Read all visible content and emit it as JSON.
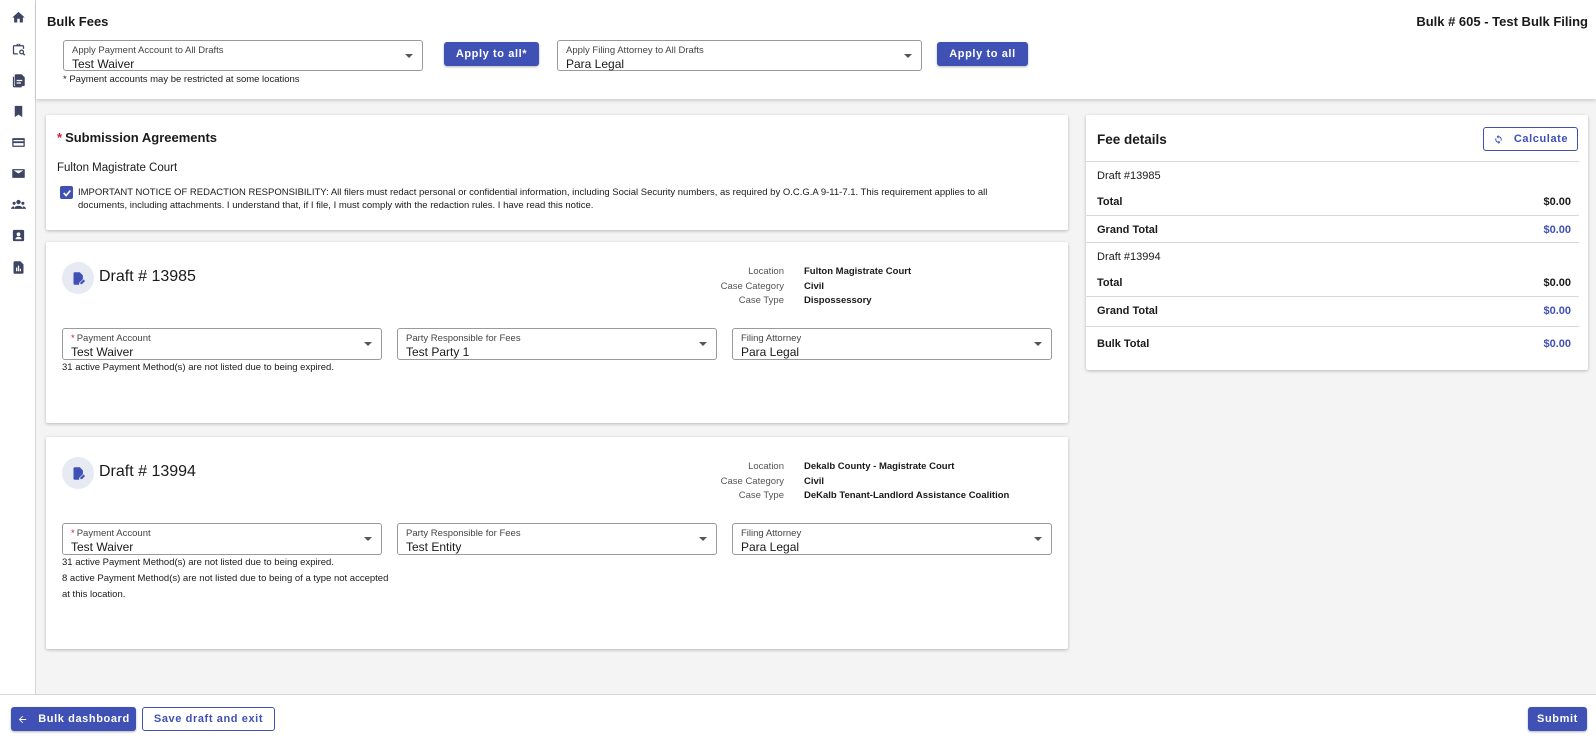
{
  "header": {
    "title": "Bulk Fees",
    "bulk_title": "Bulk # 605 - Test Bulk Filing",
    "payment_account_select": {
      "label": "Apply Payment Account to All Drafts",
      "value": "Test Waiver"
    },
    "apply_payment_label": "Apply to all*",
    "filing_attorney_select": {
      "label": "Apply Filing Attorney to All Drafts",
      "value": "Para Legal"
    },
    "apply_attorney_label": "Apply to all",
    "note": "* Payment accounts may be restricted at some locations"
  },
  "sidebar": {
    "items": [
      "home-icon",
      "briefcase-search-icon",
      "documents-icon",
      "bookmark-icon",
      "payment-card-icon",
      "mail-icon",
      "people-icon",
      "contact-card-icon",
      "report-icon"
    ]
  },
  "agreements": {
    "required_mark": "*",
    "title": "Submission Agreements",
    "court": "Fulton Magistrate Court",
    "checked": true,
    "text": "IMPORTANT NOTICE OF REDACTION RESPONSIBILITY: All filers must redact personal or confidential information, including Social Security numbers, as required by O.C.G.A 9-11-7.1. This requirement applies to all documents, including attachments. I understand that, if I file, I must comply with the redaction rules. I have read this notice."
  },
  "drafts": [
    {
      "title": "Draft # 13985",
      "location_label": "Location",
      "location": "Fulton Magistrate Court",
      "category_label": "Case Category",
      "category": "Civil",
      "type_label": "Case Type",
      "type": "Dispossessory",
      "payment_account": {
        "required": "*",
        "label": "Payment Account",
        "value": "Test Waiver"
      },
      "party": {
        "label": "Party Responsible for Fees",
        "value": "Test Party 1"
      },
      "attorney": {
        "label": "Filing Attorney",
        "value": "Para Legal"
      },
      "messages": [
        "31 active Payment Method(s) are not listed due to being expired."
      ]
    },
    {
      "title": "Draft # 13994",
      "location_label": "Location",
      "location": "Dekalb County - Magistrate Court",
      "category_label": "Case Category",
      "category": "Civil",
      "type_label": "Case Type",
      "type": "DeKalb Tenant-Landlord Assistance Coalition",
      "payment_account": {
        "required": "*",
        "label": "Payment Account",
        "value": "Test Waiver"
      },
      "party": {
        "label": "Party Responsible for Fees",
        "value": "Test Entity"
      },
      "attorney": {
        "label": "Filing Attorney",
        "value": "Para Legal"
      },
      "messages": [
        "31 active Payment Method(s) are not listed due to being expired.",
        "8 active Payment Method(s) are not listed due to being of a type not accepted",
        "at this location."
      ]
    }
  ],
  "fees": {
    "title": "Fee details",
    "calculate_label": "Calculate",
    "drafts": [
      {
        "name": "Draft #13985",
        "total_label": "Total",
        "total": "$0.00",
        "grand_label": "Grand Total",
        "grand": "$0.00"
      },
      {
        "name": "Draft #13994",
        "total_label": "Total",
        "total": "$0.00",
        "grand_label": "Grand Total",
        "grand": "$0.00"
      }
    ],
    "bulk_total_label": "Bulk Total",
    "bulk_total": "$0.00"
  },
  "footer": {
    "dashboard_label": "Bulk dashboard",
    "save_label": "Save draft and exit",
    "submit_label": "Submit"
  },
  "colors": {
    "primary": "#3f51b5",
    "required": "#d4183d"
  }
}
